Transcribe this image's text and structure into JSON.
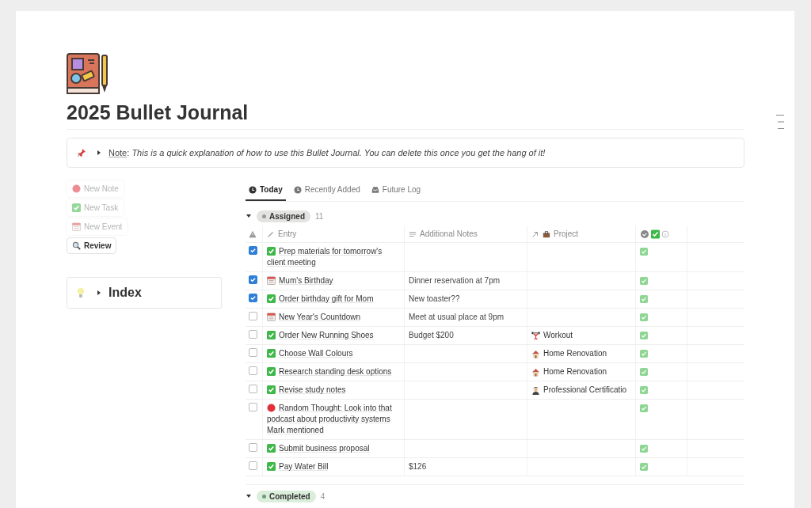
{
  "page": {
    "title": "2025 Bullet Journal"
  },
  "callout": {
    "label": "Note",
    "body": ": *This is a quick explanation of how to use this Bullet Journal. You can delete this once you get the hang of it!*"
  },
  "actions": [
    {
      "label": "New Note",
      "kind": "note",
      "disabled": true
    },
    {
      "label": "New Task",
      "kind": "task",
      "disabled": true
    },
    {
      "label": "New Event",
      "kind": "event",
      "disabled": true
    },
    {
      "label": "Review",
      "kind": "search",
      "disabled": false
    }
  ],
  "index": {
    "label": "Index",
    "expanded": false
  },
  "tabs": [
    {
      "label": "Today",
      "kind": "today",
      "selected": true
    },
    {
      "label": "Recently Added",
      "kind": "clock",
      "selected": false
    },
    {
      "label": "Future Log",
      "kind": "inbox",
      "selected": false
    }
  ],
  "groups": [
    {
      "label": "Assigned",
      "count": "11",
      "color": "#e3e3e1",
      "expanded": true
    },
    {
      "label": "Completed",
      "count": "4",
      "color": "#dbeddb",
      "expanded": true
    }
  ],
  "table": {
    "columns": [
      "Entry",
      "Additional Notes",
      "Project"
    ],
    "rows": [
      {
        "checked": true,
        "kind": "task",
        "entry": "Prep materials for tomorrow's client meeting",
        "notes": "",
        "project": null
      },
      {
        "checked": true,
        "kind": "event",
        "entry": "Mum's Birthday",
        "notes": "Dinner reservation at 7pm",
        "project": null
      },
      {
        "checked": true,
        "kind": "task",
        "entry": "Order birthday gift for Mom",
        "notes": "New toaster??",
        "project": null
      },
      {
        "checked": false,
        "kind": "event",
        "entry": "New Year's Countdown",
        "notes": "Meet at usual place at 9pm",
        "project": null
      },
      {
        "checked": false,
        "kind": "task",
        "entry": "Order New Running Shoes",
        "notes": "Budget $200",
        "project": {
          "name": "Workout",
          "kind": "workout"
        }
      },
      {
        "checked": false,
        "kind": "task",
        "entry": "Choose Wall Colours",
        "notes": "",
        "project": {
          "name": "Home Renovation",
          "kind": "house"
        }
      },
      {
        "checked": false,
        "kind": "task",
        "entry": "Research standing desk options",
        "notes": "",
        "project": {
          "name": "Home Renovation",
          "kind": "house"
        }
      },
      {
        "checked": false,
        "kind": "task",
        "entry": "Revise study notes",
        "notes": "",
        "project": {
          "name": "Professional Certificatio",
          "kind": "person"
        }
      },
      {
        "checked": false,
        "kind": "note",
        "entry": "Random Thought: Look into that podcast about productivity systems Mark mentioned",
        "notes": "",
        "project": null
      },
      {
        "checked": false,
        "kind": "task",
        "entry": "Submit business proposal",
        "notes": "",
        "project": null
      },
      {
        "checked": false,
        "kind": "task",
        "entry": "Pay Water Bill",
        "notes": "$126",
        "project": null
      }
    ]
  }
}
